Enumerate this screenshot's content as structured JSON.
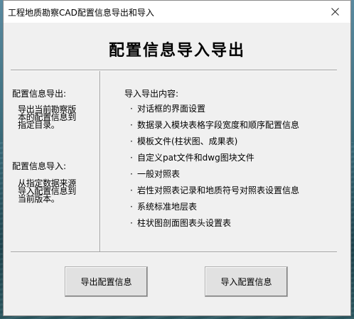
{
  "window": {
    "title": "工程地质勘察CAD配置信息导出和导入"
  },
  "main_title": "配置信息导入导出",
  "left_panel": {
    "export_heading": "配置信息导出:",
    "export_desc": "导出当前勘察版本的配置信息到指定目录。",
    "import_heading": "配置信息导入:",
    "import_desc": "从指定数据来源导入配置信息到当前版本。"
  },
  "right_panel": {
    "heading": "导入导出内容:",
    "bullet_glyph": "·",
    "items": [
      "对话框的界面设置",
      "数据录入模块表格字段宽度和顺序配置信息",
      "模板文件(柱状图、成果表)",
      "自定义pat文件和dwg图块文件",
      "一般对照表",
      "岩性对照表记录和地质符号对照表设置信息",
      "系统标准地层表",
      "柱状图剖面图表头设置表"
    ]
  },
  "buttons": {
    "export_label": "导出配置信息",
    "import_label": "导入配置信息"
  },
  "icons": {
    "close": "close-icon"
  }
}
